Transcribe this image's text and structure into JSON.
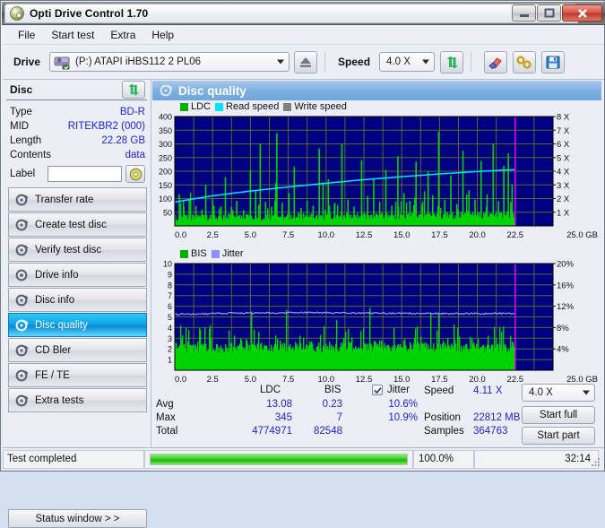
{
  "window": {
    "title": "Opti Drive Control 1.70",
    "icon": "disc-icon",
    "minimize": "minimize-icon",
    "maximize": "maximize-icon",
    "close": "close-icon"
  },
  "menu": {
    "items": [
      "File",
      "Start test",
      "Extra",
      "Help"
    ]
  },
  "toolbar": {
    "drive_label": "Drive",
    "drive_value": "(P:)  ATAPI iHBS112  2 PL06",
    "eject_icon": "eject-icon",
    "speed_label": "Speed",
    "speed_value": "4.0 X",
    "refresh_icon": "refresh-icon",
    "erase_icon": "eraser-icon",
    "tools_icon": "wrench-icon",
    "save_icon": "floppy-save-icon"
  },
  "disc_panel": {
    "header": "Disc",
    "refresh_icon": "refresh-icon",
    "rows": [
      {
        "key": "Type",
        "value": "BD-R"
      },
      {
        "key": "MID",
        "value": "RITEKBR2 (000)"
      },
      {
        "key": "Length",
        "value": "22.28 GB"
      },
      {
        "key": "Contents",
        "value": "data"
      }
    ],
    "label_key": "Label",
    "label_value": "",
    "label_button_icon": "disc-icon"
  },
  "nav": {
    "items": [
      {
        "label": "Transfer rate",
        "icon": "disc-speed-icon",
        "selected": false
      },
      {
        "label": "Create test disc",
        "icon": "disc-write-icon",
        "selected": false
      },
      {
        "label": "Verify test disc",
        "icon": "disc-check-icon",
        "selected": false
      },
      {
        "label": "Drive info",
        "icon": "drive-info-icon",
        "selected": false
      },
      {
        "label": "Disc info",
        "icon": "disc-info-icon",
        "selected": false
      },
      {
        "label": "Disc quality",
        "icon": "disc-quality-icon",
        "selected": true
      },
      {
        "label": "CD Bler",
        "icon": "disc-bler-icon",
        "selected": false
      },
      {
        "label": "FE / TE",
        "icon": "disc-fete-icon",
        "selected": false
      },
      {
        "label": "Extra tests",
        "icon": "disc-extra-icon",
        "selected": false
      }
    ],
    "status_window_button": "Status window > >"
  },
  "main": {
    "title": "Disc quality",
    "title_icon": "disc-quality-icon"
  },
  "stats": {
    "col_headers": [
      "LDC",
      "BIS"
    ],
    "jitter_label": "Jitter",
    "jitter_checked": true,
    "rows": [
      {
        "name": "Avg",
        "ldc": "13.08",
        "bis": "0.23",
        "jitter": "10.6%"
      },
      {
        "name": "Max",
        "ldc": "345",
        "bis": "7",
        "jitter": "10.9%"
      },
      {
        "name": "Total",
        "ldc": "4774971",
        "bis": "82548",
        "jitter": ""
      }
    ],
    "speed_label": "Speed",
    "speed_value": "4.11 X",
    "position_label": "Position",
    "position_value": "22812 MB",
    "samples_label": "Samples",
    "samples_value": "364763",
    "speed_select": "4.0 X",
    "start_full": "Start full",
    "start_part": "Start part"
  },
  "statusbar": {
    "message": "Test completed",
    "percent": "100.0%",
    "progress_value": 100,
    "elapsed": "32:14"
  },
  "colors": {
    "ldc": "#00d400",
    "read_speed": "#00e5ff",
    "write_speed": "#808080",
    "bis": "#00d400",
    "jitter": "#8f8fff",
    "plot_bg": "#000080",
    "grid": "#5a6a33",
    "marker": "#ff00ff",
    "accent": "#2222cc"
  },
  "chart_data": [
    {
      "type": "line",
      "name": "top-chart-disc-quality",
      "title": "",
      "xlabel": "GB",
      "ylabel": "",
      "xlim": [
        0,
        25.0
      ],
      "ylim": [
        0,
        400
      ],
      "y2lim": [
        0,
        8
      ],
      "y2label": "X",
      "xticks": [
        "0.0",
        "2.5",
        "5.0",
        "7.5",
        "10.0",
        "12.5",
        "15.0",
        "17.5",
        "20.0",
        "22.5",
        "25.0 GB"
      ],
      "yticks": [
        "50",
        "100",
        "150",
        "200",
        "250",
        "300",
        "350",
        "400"
      ],
      "y2ticks": [
        "1 X",
        "2 X",
        "3 X",
        "4 X",
        "5 X",
        "6 X",
        "7 X",
        "8 X"
      ],
      "grid": true,
      "legend": [
        {
          "label": "LDC",
          "color": "#00b000"
        },
        {
          "label": "Read speed",
          "color": "#00e5ff"
        },
        {
          "label": "Write speed",
          "color": "#808080"
        }
      ],
      "data_end_x": 22.45,
      "marker_x": 22.5,
      "series": [
        {
          "name": "Read speed",
          "color": "#00e5ff",
          "axis": "right",
          "x": [
            0.0,
            2.5,
            5.0,
            7.5,
            10.0,
            12.5,
            15.0,
            17.5,
            20.0,
            22.4
          ],
          "values": [
            1.75,
            2.2,
            2.55,
            2.85,
            3.12,
            3.38,
            3.6,
            3.8,
            3.98,
            4.11
          ]
        },
        {
          "name": "LDC",
          "color": "#00b000",
          "axis": "left",
          "baseline": 30,
          "avg": 13.08,
          "max": 345,
          "total": 4774971,
          "spikes": [
            {
              "x": 0.25,
              "y": 115
            },
            {
              "x": 0.55,
              "y": 70
            },
            {
              "x": 0.9,
              "y": 95
            },
            {
              "x": 1.35,
              "y": 72
            },
            {
              "x": 1.75,
              "y": 60
            },
            {
              "x": 2.0,
              "y": 150
            },
            {
              "x": 2.45,
              "y": 98
            },
            {
              "x": 2.9,
              "y": 64
            },
            {
              "x": 3.3,
              "y": 178
            },
            {
              "x": 3.7,
              "y": 70
            },
            {
              "x": 4.05,
              "y": 92
            },
            {
              "x": 4.5,
              "y": 58
            },
            {
              "x": 4.95,
              "y": 204
            },
            {
              "x": 5.3,
              "y": 128
            },
            {
              "x": 5.6,
              "y": 300
            },
            {
              "x": 5.95,
              "y": 88
            },
            {
              "x": 6.35,
              "y": 70
            },
            {
              "x": 6.7,
              "y": 340
            },
            {
              "x": 7.05,
              "y": 84
            },
            {
              "x": 7.5,
              "y": 120
            },
            {
              "x": 7.85,
              "y": 217
            },
            {
              "x": 8.3,
              "y": 66
            },
            {
              "x": 8.7,
              "y": 92
            },
            {
              "x": 9.1,
              "y": 74
            },
            {
              "x": 9.5,
              "y": 283
            },
            {
              "x": 9.75,
              "y": 160
            },
            {
              "x": 10.1,
              "y": 171
            },
            {
              "x": 10.5,
              "y": 78
            },
            {
              "x": 11.0,
              "y": 300
            },
            {
              "x": 11.4,
              "y": 96
            },
            {
              "x": 11.8,
              "y": 70
            },
            {
              "x": 12.3,
              "y": 240
            },
            {
              "x": 12.7,
              "y": 110
            },
            {
              "x": 13.1,
              "y": 170
            },
            {
              "x": 13.5,
              "y": 88
            },
            {
              "x": 13.9,
              "y": 205
            },
            {
              "x": 14.3,
              "y": 74
            },
            {
              "x": 14.7,
              "y": 255
            },
            {
              "x": 15.1,
              "y": 120
            },
            {
              "x": 15.5,
              "y": 92
            },
            {
              "x": 15.9,
              "y": 235
            },
            {
              "x": 16.3,
              "y": 78
            },
            {
              "x": 16.7,
              "y": 200
            },
            {
              "x": 17.0,
              "y": 112
            },
            {
              "x": 17.4,
              "y": 345
            },
            {
              "x": 17.8,
              "y": 96
            },
            {
              "x": 18.2,
              "y": 185
            },
            {
              "x": 18.6,
              "y": 80
            },
            {
              "x": 19.0,
              "y": 275
            },
            {
              "x": 19.4,
              "y": 130
            },
            {
              "x": 19.8,
              "y": 96
            },
            {
              "x": 20.2,
              "y": 238
            },
            {
              "x": 20.6,
              "y": 115
            },
            {
              "x": 21.0,
              "y": 300
            },
            {
              "x": 21.35,
              "y": 90
            },
            {
              "x": 21.7,
              "y": 220
            },
            {
              "x": 22.0,
              "y": 265
            },
            {
              "x": 22.25,
              "y": 150
            }
          ]
        }
      ]
    },
    {
      "type": "line",
      "name": "bottom-chart-bis-jitter",
      "title": "",
      "xlabel": "GB",
      "ylabel": "",
      "xlim": [
        0,
        25.0
      ],
      "ylim": [
        0,
        10
      ],
      "y2lim": [
        0,
        20
      ],
      "y2label": "%",
      "xticks": [
        "0.0",
        "2.5",
        "5.0",
        "7.5",
        "10.0",
        "12.5",
        "15.0",
        "17.5",
        "20.0",
        "22.5",
        "25.0 GB"
      ],
      "yticks": [
        "1",
        "2",
        "3",
        "4",
        "5",
        "6",
        "7",
        "8",
        "9",
        "10"
      ],
      "y2ticks": [
        "4%",
        "8%",
        "12%",
        "16%",
        "20%"
      ],
      "grid": true,
      "legend": [
        {
          "label": "BIS",
          "color": "#00b000"
        },
        {
          "label": "Jitter",
          "color": "#8f8fff"
        }
      ],
      "data_end_x": 22.45,
      "marker_x": 22.5,
      "series": [
        {
          "name": "Jitter",
          "color": "#8f8fff",
          "axis": "right",
          "avg": "10.6%",
          "max": "10.9%",
          "values_percent_range": [
            10.2,
            11.0
          ]
        },
        {
          "name": "BIS",
          "color": "#00b000",
          "axis": "left",
          "baseline": 2,
          "avg": 0.23,
          "max": 7,
          "total": 82548
        }
      ]
    }
  ]
}
